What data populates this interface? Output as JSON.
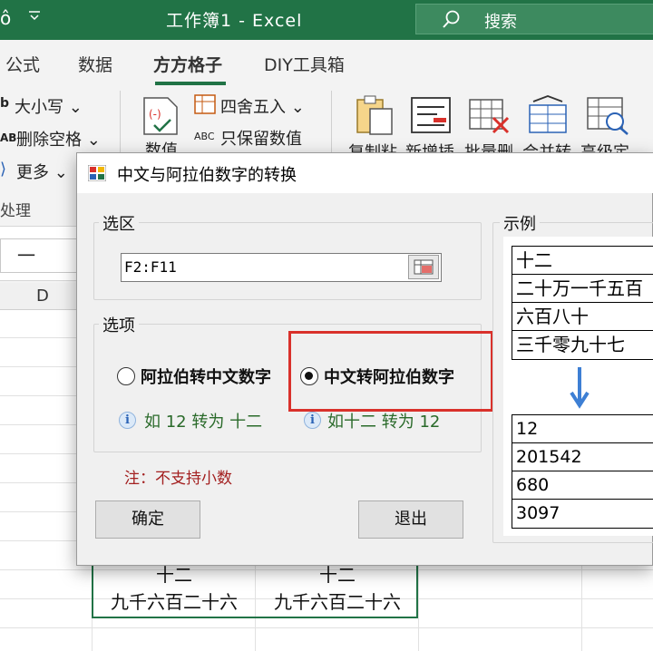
{
  "window": {
    "title": "工作簿1  -  Excel",
    "app_glyph": "ô",
    "search_placeholder": "搜索"
  },
  "tabs": [
    "公式",
    "数据",
    "方方格子",
    "DIY工具箱"
  ],
  "active_tab": "方方格子",
  "ribbon": {
    "case_prefix": "b",
    "case_label": "大小写 ⌄",
    "trim_prefix": "AB",
    "trim_label": "删除空格 ⌄",
    "more_prefix": "⟩",
    "more_label": "更多 ⌄",
    "group_label": "处理",
    "round_label": "四舍五入  ⌄",
    "keep_prefix": "ABC",
    "keep_label": "只保留数值",
    "numeric_label": "数值",
    "copy_label": "复制粘",
    "insert_label": "新增插",
    "batch_delete_label": "批量删",
    "merge_label": "合并转",
    "find_label": "高级定"
  },
  "sheet": {
    "name_box": "一",
    "column_d": "D",
    "cells": [
      "十二",
      "十二",
      "九千六百二十六",
      "九千六百二十六"
    ]
  },
  "dialog": {
    "title": "中文与阿拉伯数字的转换",
    "selection_group": "选区",
    "range_value": "F2:F11",
    "options_group": "选项",
    "option_arabic_to_chinese": "阿拉伯转中文数字",
    "option_chinese_to_arabic": "中文转阿拉伯数字",
    "selected_option": "chinese_to_arabic",
    "hint_arabic_to_chinese": "如 12 转为 十二",
    "hint_chinese_to_arabic": "如十二  转为 12",
    "note": "注：不支持小数",
    "ok_button": "确定",
    "exit_button": "退出",
    "example_group": "示例",
    "example_chinese": [
      "十二",
      "二十万一千五百",
      "六百八十",
      "三千零九十七"
    ],
    "example_arabic": [
      "12",
      "201542",
      "680",
      "3097"
    ]
  },
  "colors": {
    "excel_green": "#217346",
    "highlight_red": "#d9312b",
    "arrow_blue": "#3d7fd4",
    "note_red": "#a32020"
  }
}
